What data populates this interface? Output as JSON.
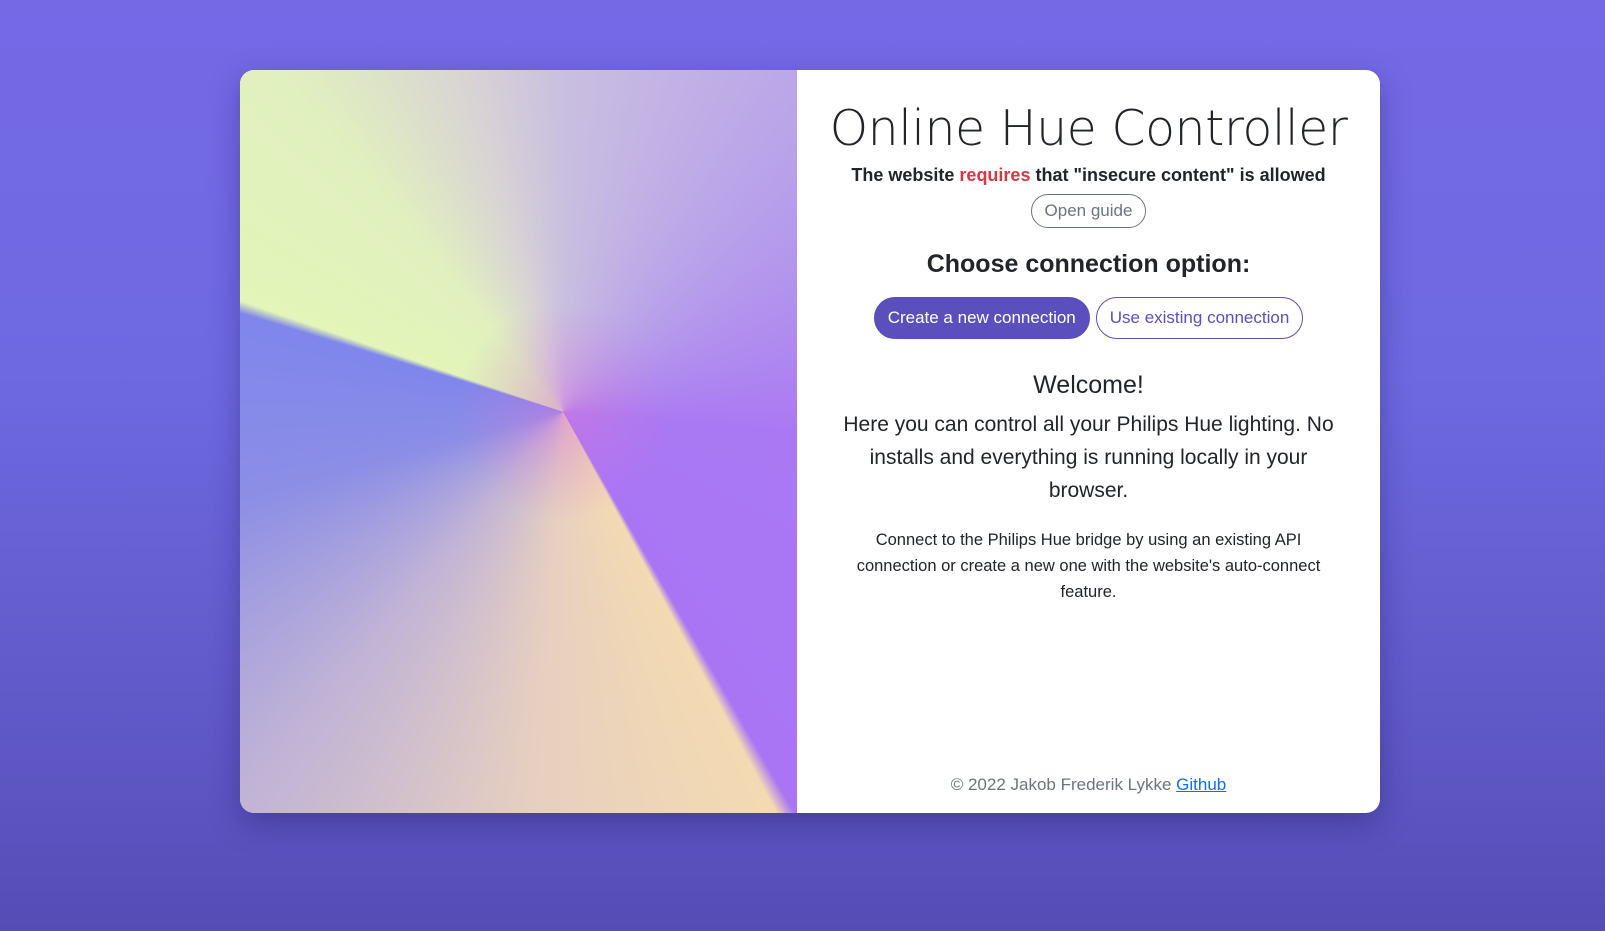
{
  "header": {
    "title": "Online Hue Controller",
    "notice_prefix": "The website ",
    "notice_highlight": "requires",
    "notice_suffix": " that \"insecure content\" is allowed",
    "guide_button": "Open guide"
  },
  "connection": {
    "heading": "Choose connection option:",
    "create_button": "Create a new connection",
    "existing_button": "Use existing connection"
  },
  "welcome": {
    "heading": "Welcome!",
    "text": "Here you can control all your Philips Hue lighting. No installs and everything is running locally in your browser.",
    "connect_text": "Connect to the Philips Hue bridge by using an existing API connection or create a new one with the website's auto-connect feature."
  },
  "footer": {
    "copyright": "© 2022 Jakob Frederik Lykke ",
    "github_link": "Github"
  },
  "colors": {
    "primary": "#5a4fbc",
    "danger": "#dc3545",
    "muted": "#6c757d",
    "link": "#0d6efd"
  }
}
